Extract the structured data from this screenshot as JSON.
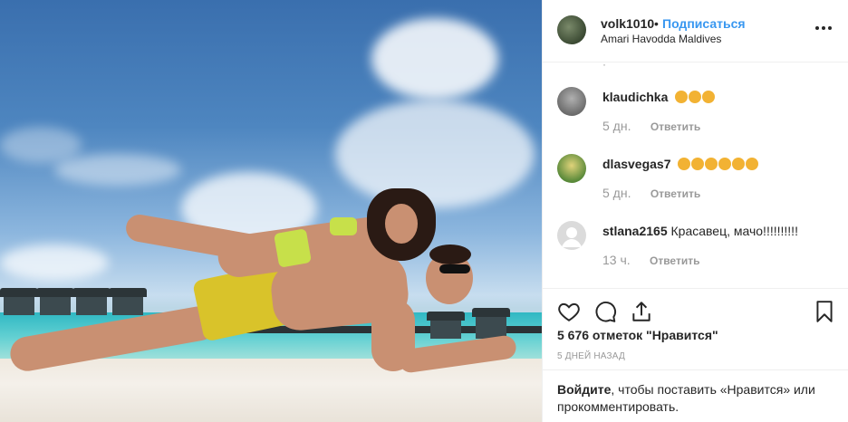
{
  "post": {
    "username": "volk1010",
    "separator": "•",
    "follow_label": "Подписаться",
    "location": "Amari Havodda Maldives",
    "likes_text": "5 676 отметок \"Нравится\"",
    "date_label": "5 ДНЕЙ НАЗАД"
  },
  "comments_list": [
    {
      "username": "klaudichka",
      "text": "",
      "emojis": [
        "clapping-hands",
        "ok-hand",
        "thumbs-up"
      ],
      "time": "5 дн.",
      "reply_label": "Ответить"
    },
    {
      "username": "dlasvegas7",
      "text": "",
      "emojis": [
        "clapping-hands",
        "clapping-hands",
        "clapping-hands",
        "clapping-hands",
        "clapping-hands",
        "clapping-hands"
      ],
      "time": "5 дн.",
      "reply_label": "Ответить"
    },
    {
      "username": "stlana2165",
      "text": "Красавец, мачо!!!!!!!!!!",
      "emojis": [],
      "time": "13 ч.",
      "reply_label": "Ответить"
    }
  ],
  "actions": {
    "icons": [
      "heart-icon",
      "comment-icon",
      "share-icon",
      "bookmark-icon"
    ]
  },
  "login_prompt": {
    "link_text": "Войдите",
    "rest_text": ", чтобы поставить «Нравится» или прокомментировать."
  },
  "colors": {
    "accent": "#3897f0",
    "muted": "#999999",
    "text": "#262626",
    "border": "#efefef"
  }
}
